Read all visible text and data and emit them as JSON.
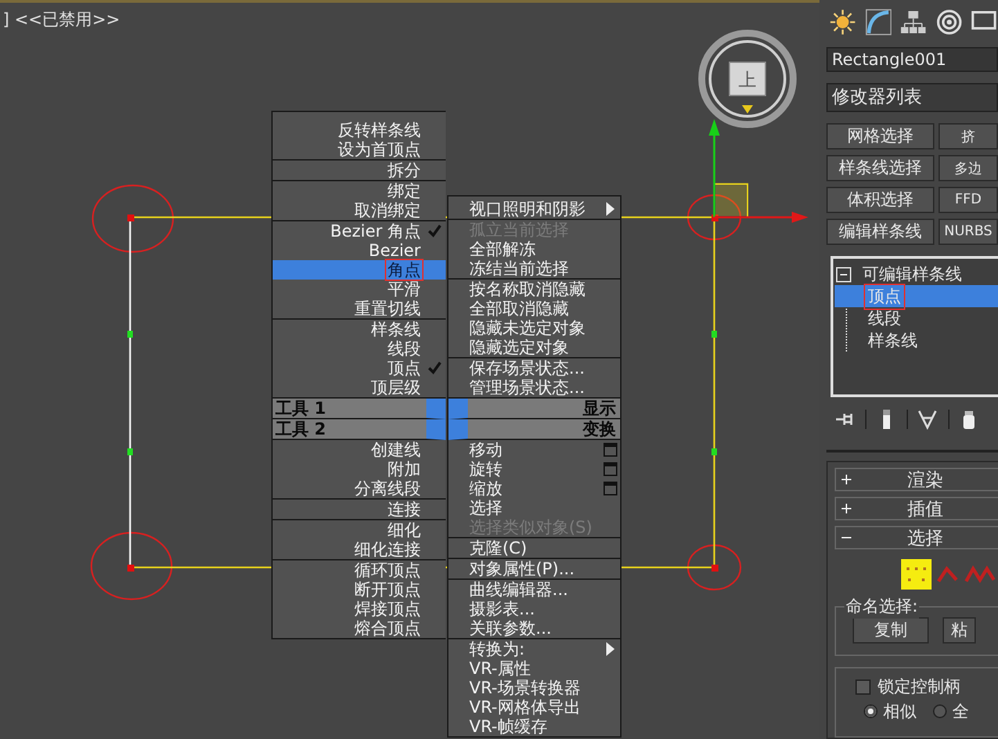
{
  "viewport": {
    "label": "] <<已禁用>>",
    "viewcube_label": "上"
  },
  "quad_menu": {
    "left": {
      "top_groups": [
        [
          {
            "label": "反转样条线",
            "checked": false,
            "selected": false,
            "marked": false
          },
          {
            "label": "设为首顶点",
            "checked": false,
            "selected": false,
            "marked": false
          }
        ],
        [
          {
            "label": "拆分",
            "checked": false,
            "selected": false,
            "marked": false
          }
        ],
        [
          {
            "label": "绑定",
            "checked": false,
            "selected": false,
            "marked": false
          },
          {
            "label": "取消绑定",
            "checked": false,
            "selected": false,
            "marked": false
          }
        ],
        [
          {
            "label": "Bezier 角点",
            "checked": true,
            "selected": false,
            "marked": false
          },
          {
            "label": "Bezier",
            "checked": false,
            "selected": false,
            "marked": false
          },
          {
            "label": "角点",
            "checked": false,
            "selected": true,
            "marked": true
          },
          {
            "label": "平滑",
            "checked": false,
            "selected": false,
            "marked": false
          },
          {
            "label": "重置切线",
            "checked": false,
            "selected": false,
            "marked": false
          }
        ],
        [
          {
            "label": "样条线",
            "checked": false,
            "selected": false,
            "marked": false
          },
          {
            "label": "线段",
            "checked": false,
            "selected": false,
            "marked": false
          },
          {
            "label": "顶点",
            "checked": true,
            "selected": false,
            "marked": false
          },
          {
            "label": "顶层级",
            "checked": false,
            "selected": false,
            "marked": false
          }
        ]
      ],
      "headers": [
        "工具 1",
        "工具 2"
      ],
      "bottom_groups": [
        [
          {
            "label": "创建线",
            "checked": false,
            "selected": false,
            "marked": false
          },
          {
            "label": "附加",
            "checked": false,
            "selected": false,
            "marked": false
          },
          {
            "label": "分离线段",
            "checked": false,
            "selected": false,
            "marked": false
          }
        ],
        [
          {
            "label": "连接",
            "checked": false,
            "selected": false,
            "marked": false
          }
        ],
        [
          {
            "label": "细化",
            "checked": false,
            "selected": false,
            "marked": false
          },
          {
            "label": "细化连接",
            "checked": false,
            "selected": false,
            "marked": false
          }
        ],
        [
          {
            "label": "循环顶点",
            "checked": false,
            "selected": false,
            "marked": false
          },
          {
            "label": "断开顶点",
            "checked": false,
            "selected": false,
            "marked": false
          },
          {
            "label": "焊接顶点",
            "checked": false,
            "selected": false,
            "marked": false
          },
          {
            "label": "熔合顶点",
            "checked": false,
            "selected": false,
            "marked": false
          }
        ]
      ]
    },
    "right": {
      "top_groups": [
        [
          {
            "label": "视口照明和阴影",
            "kind": "submenu",
            "disabled": false
          }
        ],
        [
          {
            "label": "孤立当前选择",
            "kind": "plain",
            "disabled": true
          },
          {
            "label": "全部解冻",
            "kind": "plain",
            "disabled": false
          },
          {
            "label": "冻结当前选择",
            "kind": "plain",
            "disabled": false
          }
        ],
        [
          {
            "label": "按名称取消隐藏",
            "kind": "plain",
            "disabled": false
          },
          {
            "label": "全部取消隐藏",
            "kind": "plain",
            "disabled": false
          },
          {
            "label": "隐藏未选定对象",
            "kind": "plain",
            "disabled": false
          },
          {
            "label": "隐藏选定对象",
            "kind": "plain",
            "disabled": false
          }
        ],
        [
          {
            "label": "保存场景状态...",
            "kind": "plain",
            "disabled": false
          },
          {
            "label": "管理场景状态...",
            "kind": "plain",
            "disabled": false
          }
        ]
      ],
      "headers": [
        "显示",
        "变换"
      ],
      "bottom_groups": [
        [
          {
            "label": "移动",
            "kind": "options",
            "disabled": false
          },
          {
            "label": "旋转",
            "kind": "options",
            "disabled": false
          },
          {
            "label": "缩放",
            "kind": "options",
            "disabled": false
          },
          {
            "label": "选择",
            "kind": "plain",
            "disabled": false
          },
          {
            "label": "选择类似对象(S)",
            "kind": "plain",
            "disabled": true
          }
        ],
        [
          {
            "label": "克隆(C)",
            "kind": "plain",
            "disabled": false
          }
        ],
        [
          {
            "label": "对象属性(P)...",
            "kind": "plain",
            "disabled": false
          }
        ],
        [
          {
            "label": "曲线编辑器...",
            "kind": "plain",
            "disabled": false
          },
          {
            "label": "摄影表...",
            "kind": "plain",
            "disabled": false
          },
          {
            "label": "关联参数...",
            "kind": "plain",
            "disabled": false
          }
        ],
        [
          {
            "label": "转换为:",
            "kind": "submenu",
            "disabled": false
          },
          {
            "label": "VR-属性",
            "kind": "plain",
            "disabled": false
          },
          {
            "label": "VR-场景转换器",
            "kind": "plain",
            "disabled": false
          },
          {
            "label": "VR-网格体导出",
            "kind": "plain",
            "disabled": false
          },
          {
            "label": "VR-帧缓存",
            "kind": "plain",
            "disabled": false
          }
        ]
      ]
    }
  },
  "command_panel": {
    "object_name": "Rectangle001",
    "modifier_list": "修改器列表",
    "modifier_buttons": [
      "网格选择",
      "挤",
      "样条线选择",
      "多边",
      "体积选择",
      "FFD",
      "编辑样条线",
      "NURBS"
    ],
    "stack": [
      {
        "label": "可编辑样条线",
        "expanded": true,
        "selected": false,
        "marked": false,
        "children": [
          {
            "label": "顶点",
            "selected": true,
            "marked": true
          },
          {
            "label": "线段",
            "selected": false,
            "marked": false
          },
          {
            "label": "样条线",
            "selected": false,
            "marked": false
          }
        ]
      }
    ],
    "rollouts": [
      {
        "label": "渲染",
        "expanded": false
      },
      {
        "label": "插值",
        "expanded": false
      },
      {
        "label": "选择",
        "expanded": true
      }
    ],
    "named_selection": {
      "title": "命名选择:",
      "buttons": [
        "复制",
        "粘"
      ]
    },
    "lock_handles": {
      "label": "锁定控制柄",
      "checked": false
    },
    "radios": [
      {
        "label": "相似",
        "selected": true
      },
      {
        "label": "全",
        "selected": false
      }
    ]
  }
}
